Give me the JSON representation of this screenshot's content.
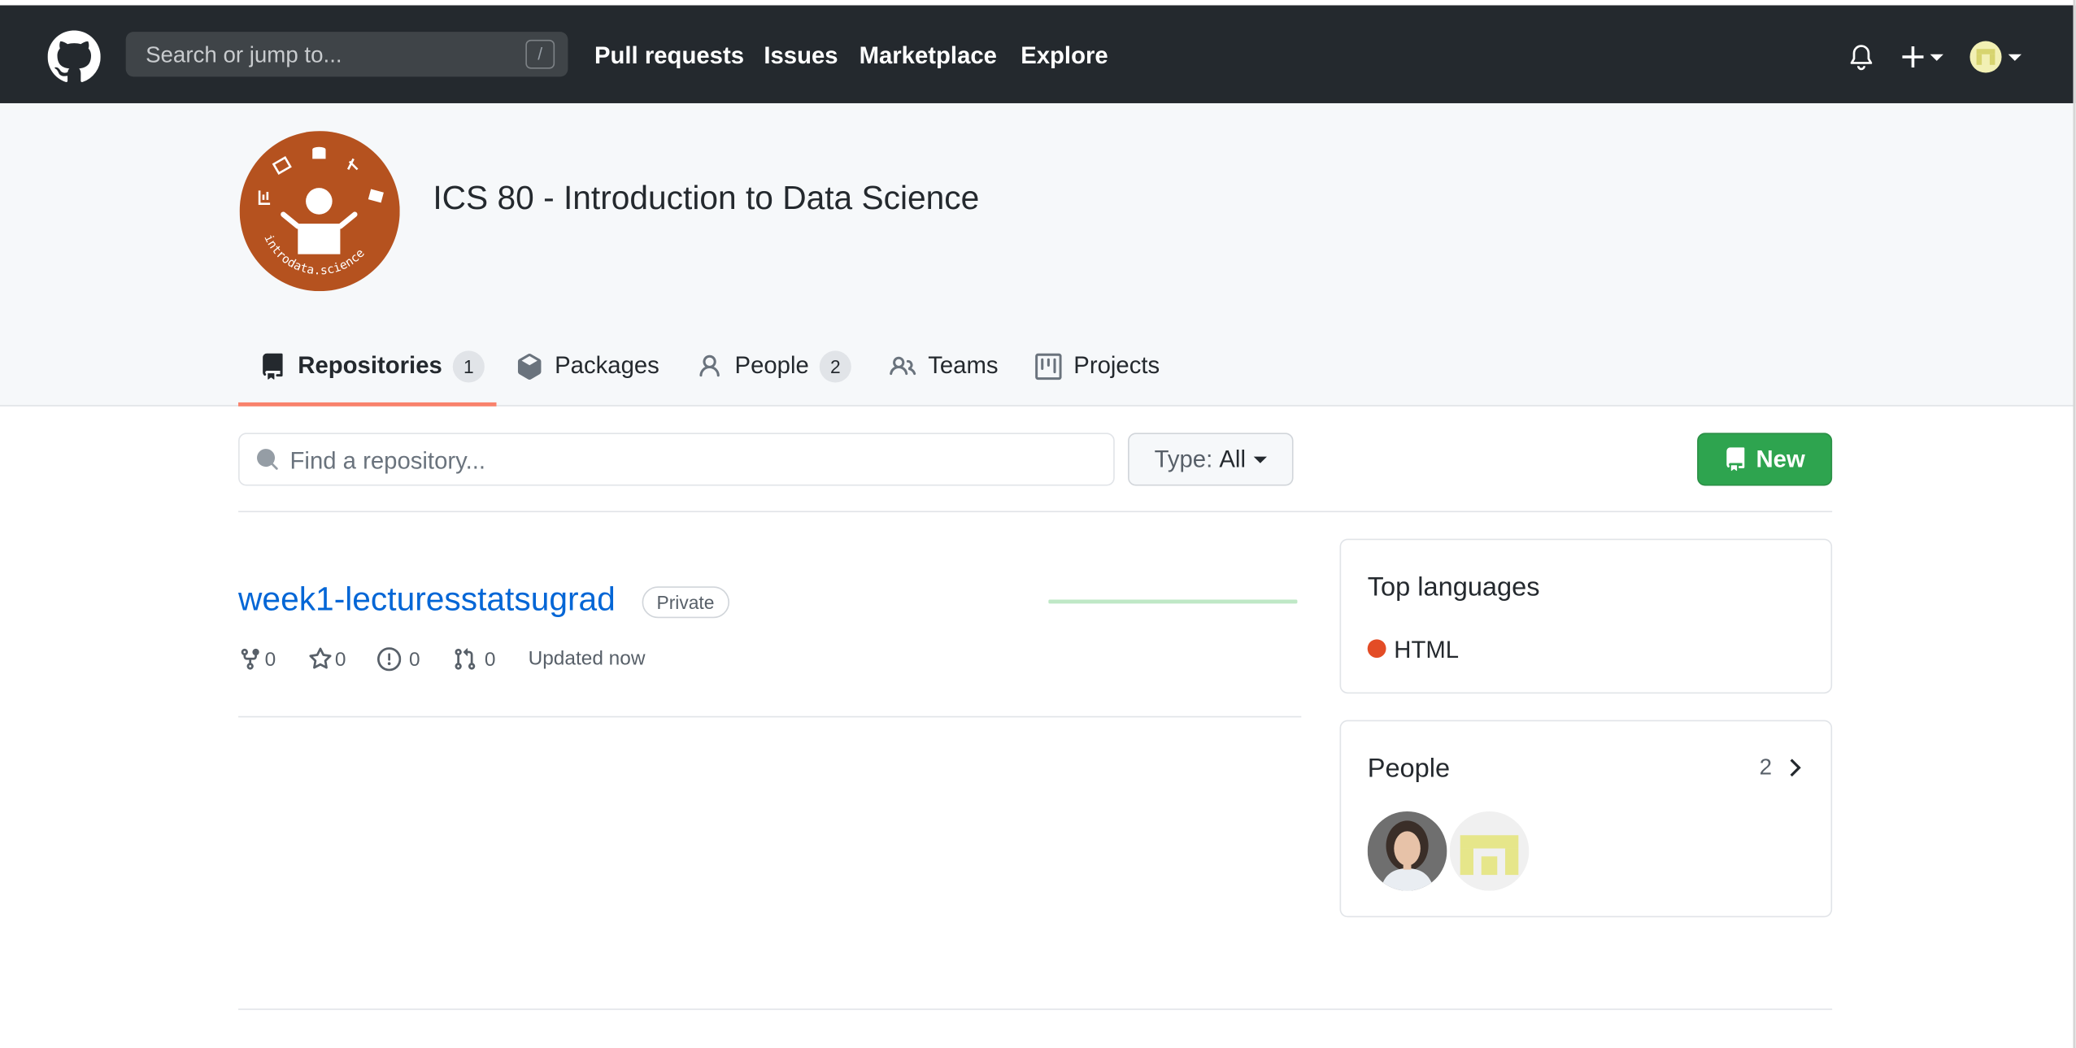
{
  "header": {
    "search_placeholder": "Search or jump to...",
    "search_shortcut": "/",
    "nav": [
      "Pull requests",
      "Issues",
      "Marketplace",
      "Explore"
    ]
  },
  "org": {
    "name": "ICS 80 - Introduction to Data Science",
    "logo_text": "introdata.science"
  },
  "tabs": [
    {
      "label": "Repositories",
      "count": "1"
    },
    {
      "label": "Packages"
    },
    {
      "label": "People",
      "count": "2"
    },
    {
      "label": "Teams"
    },
    {
      "label": "Projects"
    }
  ],
  "filter": {
    "find_placeholder": "Find a repository...",
    "type_label": "Type:",
    "type_value": "All",
    "new_label": "New"
  },
  "repo": {
    "name": "week1-lecturesstatsugrad",
    "visibility": "Private",
    "forks": "0",
    "stars": "0",
    "issues": "0",
    "pull_requests": "0",
    "updated": "Updated now"
  },
  "sidebar": {
    "languages_title": "Top languages",
    "language": "HTML",
    "language_color": "#e34c26",
    "people_title": "People",
    "people_count": "2"
  },
  "colors": {
    "header_bg": "#24292e",
    "link": "#0366d6",
    "tab_underline": "#f9826c",
    "new_button": "#2ea44f",
    "org_logo": "#b5521f"
  }
}
